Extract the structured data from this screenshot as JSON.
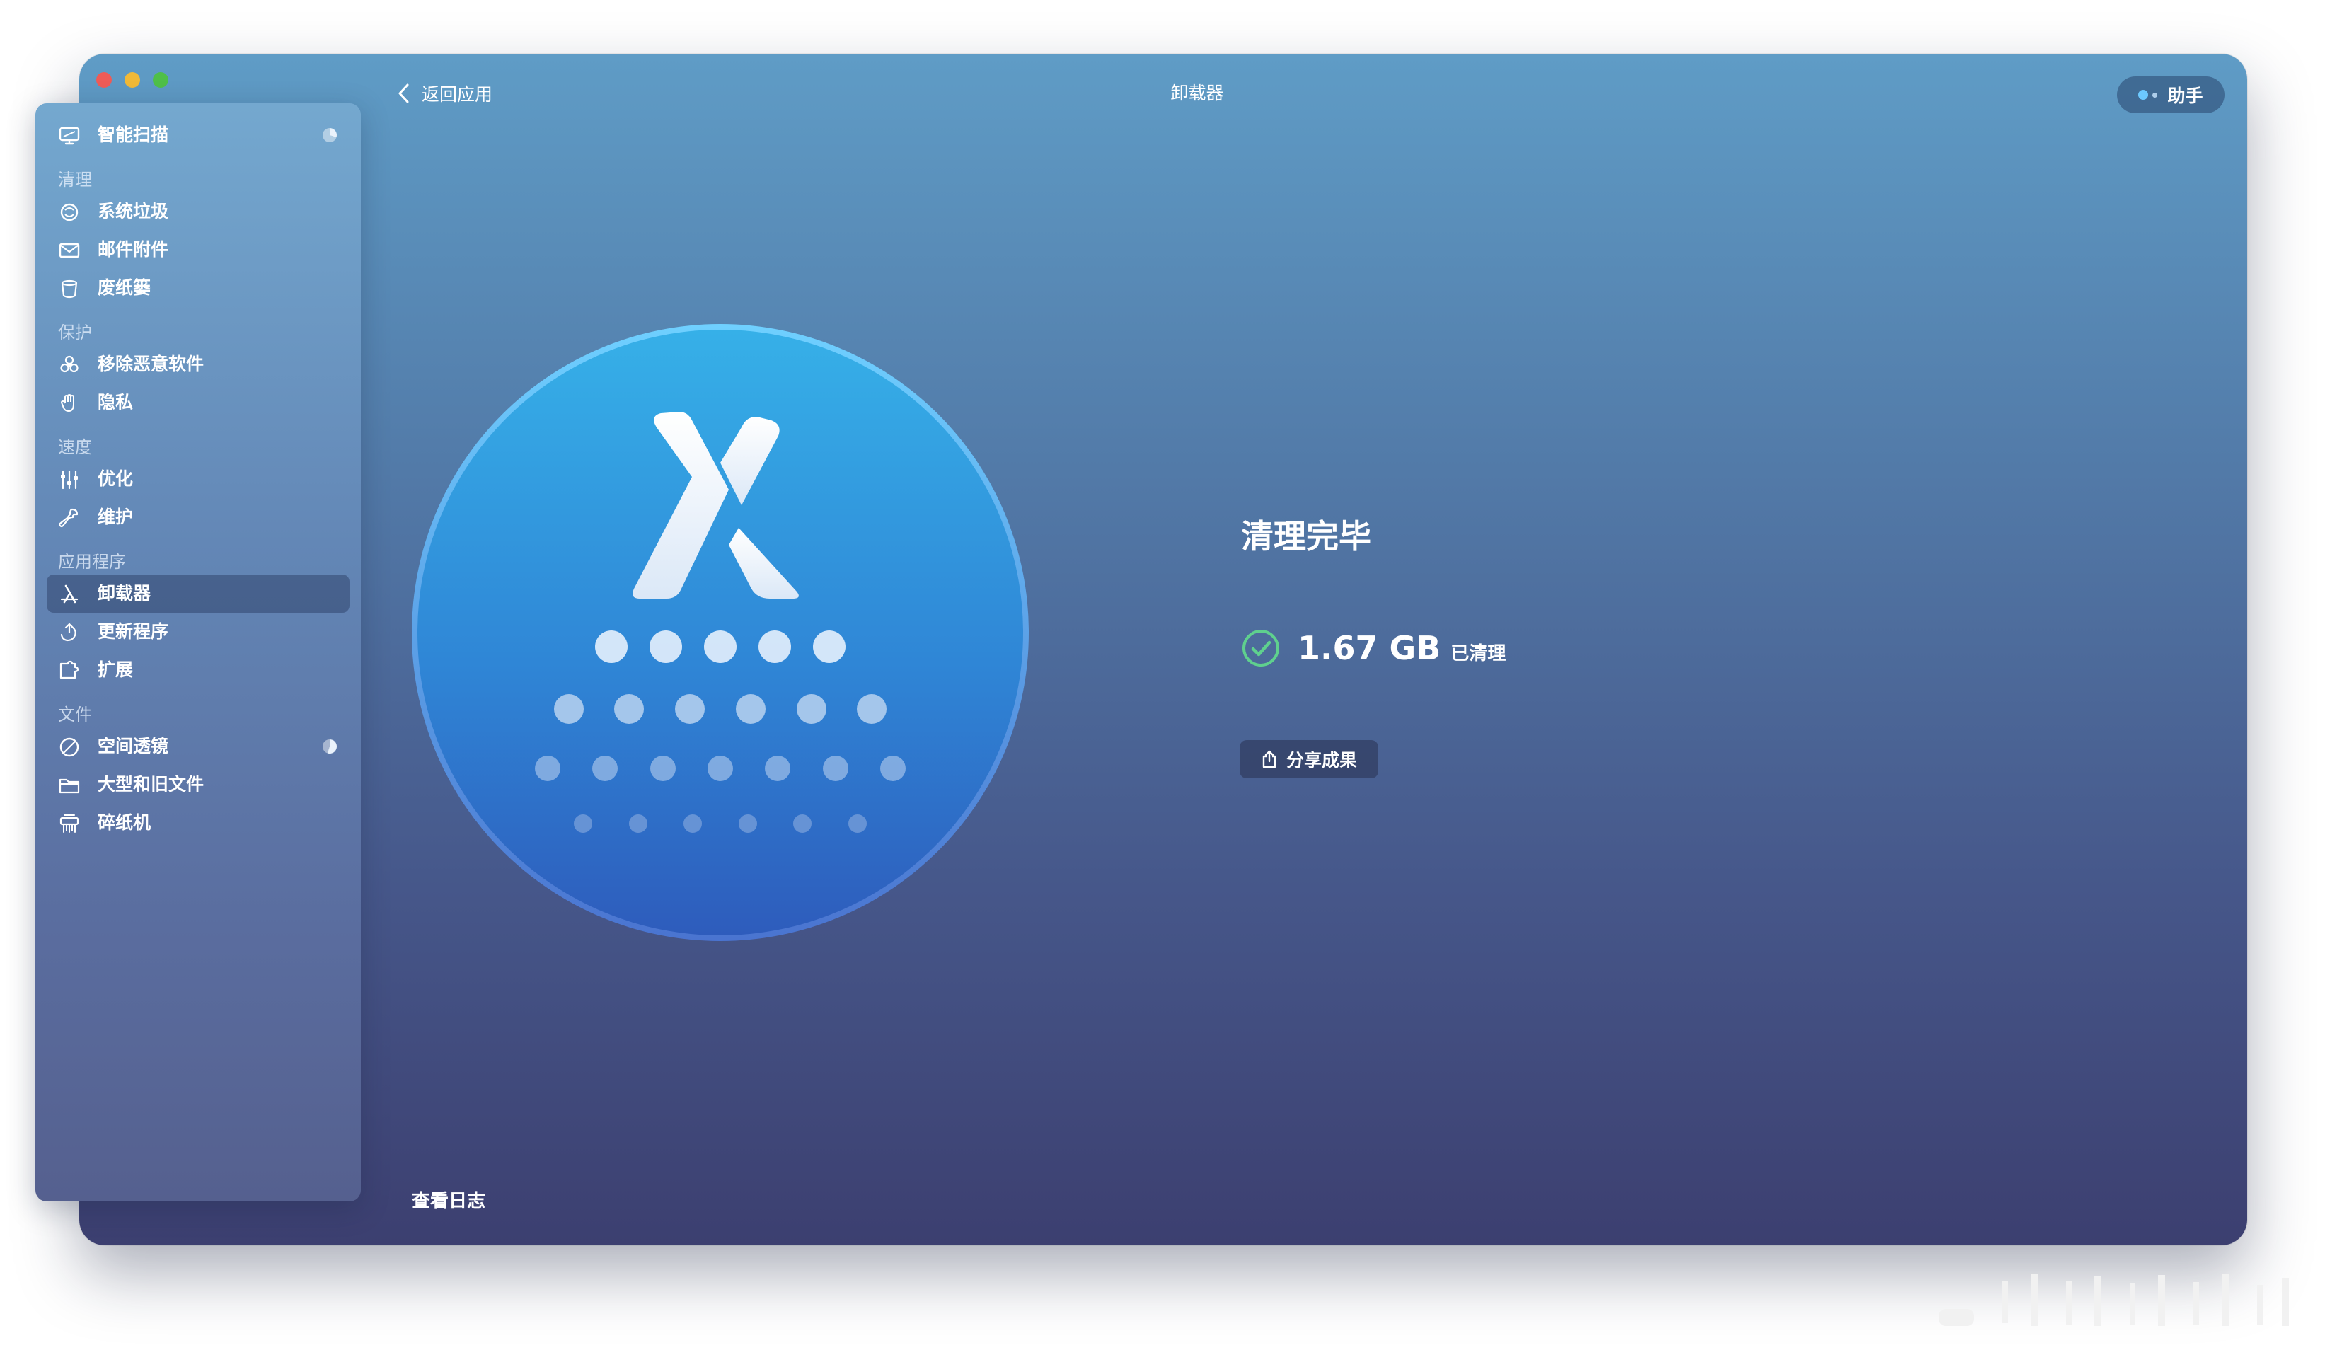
{
  "window": {
    "title": "卸载器",
    "back_label": "返回应用",
    "assistant_label": "助手"
  },
  "sidebar": {
    "smart_scan": {
      "label": "智能扫描",
      "icon": "monitor-icon"
    },
    "sections": [
      {
        "title": "清理",
        "items": [
          {
            "label": "系统垃圾",
            "icon": "system-junk-icon"
          },
          {
            "label": "邮件附件",
            "icon": "mail-icon"
          },
          {
            "label": "废纸篓",
            "icon": "trash-icon"
          }
        ]
      },
      {
        "title": "保护",
        "items": [
          {
            "label": "移除恶意软件",
            "icon": "biohazard-icon"
          },
          {
            "label": "隐私",
            "icon": "hand-icon"
          }
        ]
      },
      {
        "title": "速度",
        "items": [
          {
            "label": "优化",
            "icon": "sliders-icon"
          },
          {
            "label": "维护",
            "icon": "wrench-icon"
          }
        ]
      },
      {
        "title": "应用程序",
        "items": [
          {
            "label": "卸载器",
            "icon": "uninstaller-icon",
            "active": true
          },
          {
            "label": "更新程序",
            "icon": "updater-icon"
          },
          {
            "label": "扩展",
            "icon": "extensions-icon"
          }
        ]
      },
      {
        "title": "文件",
        "items": [
          {
            "label": "空间透镜",
            "icon": "space-lens-icon"
          },
          {
            "label": "大型和旧文件",
            "icon": "folder-icon"
          },
          {
            "label": "碎纸机",
            "icon": "shredder-icon"
          }
        ]
      }
    ]
  },
  "main": {
    "status_title": "清理完毕",
    "cleaned_size": "1.67 GB",
    "cleaned_label": "已清理",
    "share_label": "分享成果",
    "view_log_label": "查看日志"
  },
  "colors": {
    "window_top": "#5f9cc6",
    "window_bottom": "#3c3f70",
    "sidebar_active": "#37507a",
    "check_green": "#5fd08e",
    "hero_top": "#34aee6",
    "hero_bottom": "#2f5fc0"
  }
}
